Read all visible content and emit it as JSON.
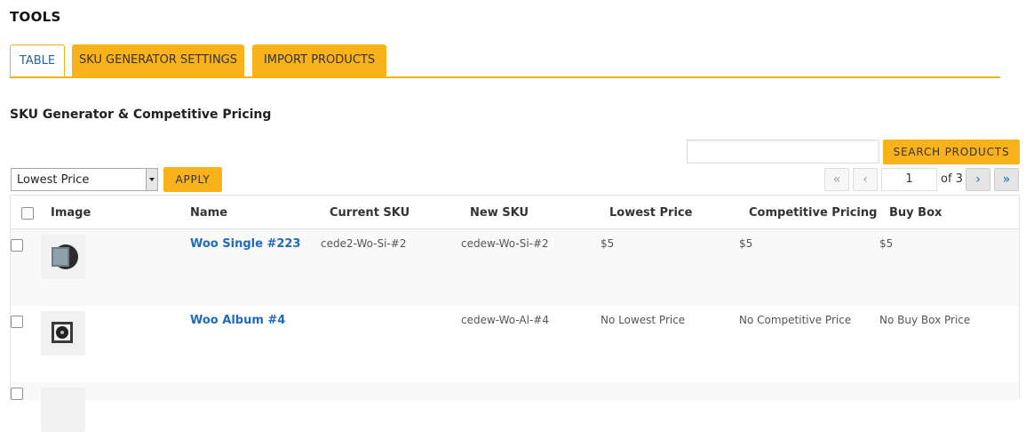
{
  "page": {
    "title": "TOOLS"
  },
  "tabs": [
    {
      "label": "TABLE",
      "active": true
    },
    {
      "label": "SKU GENERATOR SETTINGS",
      "active": false
    },
    {
      "label": "IMPORT PRODUCTS",
      "active": false
    }
  ],
  "section": {
    "title": "SKU Generator & Competitive Pricing"
  },
  "search": {
    "value": "",
    "button_label": "SEARCH PRODUCTS"
  },
  "bulk": {
    "selected": "Lowest Price",
    "apply_label": "APPLY"
  },
  "pagination": {
    "first": "«",
    "prev": "‹",
    "next": "›",
    "last": "»",
    "current": "1",
    "of_label": "of 3"
  },
  "table": {
    "columns": [
      "Image",
      "Name",
      "Current SKU",
      "New SKU",
      "Lowest Price",
      "Competitive Pricing",
      "Buy Box"
    ],
    "rows": [
      {
        "name": "Woo Single #223",
        "current_sku": "cede2-Wo-Si-#2",
        "new_sku": "cedew-Wo-Si-#2",
        "lowest_price": "$5",
        "competitive_pricing": "$5",
        "buy_box": "$5"
      },
      {
        "name": "Woo Album #4",
        "current_sku": "",
        "new_sku": "cedew-Wo-Al-#4",
        "lowest_price": "No Lowest Price",
        "competitive_pricing": "No Competitive Price",
        "buy_box": "No Buy Box Price"
      }
    ]
  },
  "colors": {
    "accent": "#f9b219",
    "link": "#1f6bbd"
  }
}
